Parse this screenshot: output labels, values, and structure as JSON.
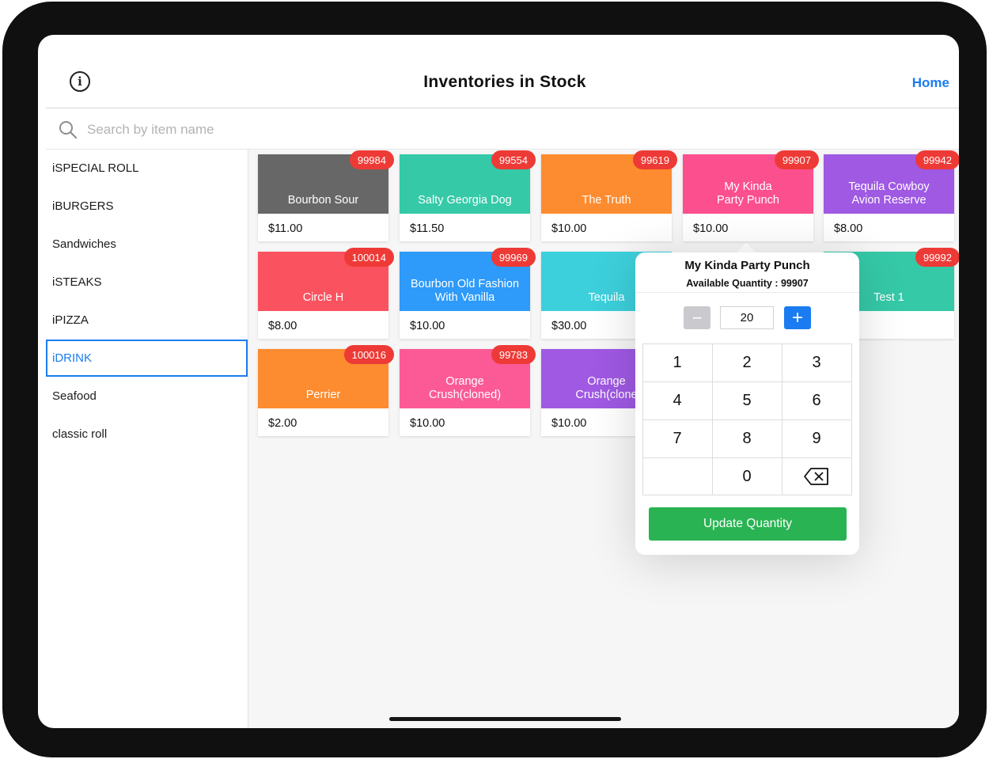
{
  "header": {
    "title": "Inventories in Stock",
    "home_label": "Home",
    "info_icon": "info-circle-icon"
  },
  "search": {
    "placeholder": "Search by item name",
    "icon": "search-icon"
  },
  "sidebar": {
    "selected": "iDRINK",
    "items": [
      {
        "label": "iSPECIAL ROLL"
      },
      {
        "label": "iBURGERS"
      },
      {
        "label": "Sandwiches"
      },
      {
        "label": "iSTEAKS"
      },
      {
        "label": "iPIZZA"
      },
      {
        "label": "iDRINK"
      },
      {
        "label": "Seafood"
      },
      {
        "label": "classic roll"
      }
    ]
  },
  "items": [
    {
      "name": "Bourbon Sour",
      "price": "$11.00",
      "stock": "99984",
      "color": "#676767"
    },
    {
      "name": "Salty Georgia Dog",
      "price": "$11.50",
      "stock": "99554",
      "color": "#35c9a8"
    },
    {
      "name": "The Truth",
      "price": "$10.00",
      "stock": "99619",
      "color": "#fd8b2f"
    },
    {
      "name": "My Kinda\nParty Punch",
      "price": "$10.00",
      "stock": "99907",
      "color": "#fb4f8e"
    },
    {
      "name": "Tequila Cowboy\nAvion Reserve",
      "price": "$8.00",
      "stock": "99942",
      "color": "#9f59e3"
    },
    {
      "name": "Circle H",
      "price": "$8.00",
      "stock": "100014",
      "color": "#fb5260"
    },
    {
      "name": "Bourbon Old Fashion\nWith Vanilla",
      "price": "$10.00",
      "stock": "99969",
      "color": "#2e9af9"
    },
    {
      "name": "Tequila",
      "price": "$30.00",
      "stock": "",
      "color": "#3cd0dc"
    },
    {
      "name": "Test 1",
      "price": "",
      "stock": "99992",
      "color": "#35c9a8"
    },
    {
      "name": "Perrier",
      "price": "$2.00",
      "stock": "100016",
      "color": "#fd8b2f"
    },
    {
      "name": "Orange\nCrush(cloned)",
      "price": "$10.00",
      "stock": "99783",
      "color": "#fb5a96"
    },
    {
      "name": "Orange\nCrush(clone",
      "price": "$10.00",
      "stock": "",
      "color": "#9f59e3"
    }
  ],
  "popover": {
    "title": "My Kinda Party Punch",
    "available": "Available Quantity : 99907",
    "minus_label": "−",
    "quantity": "20",
    "plus_label": "+",
    "keys": [
      "1",
      "2",
      "3",
      "4",
      "5",
      "6",
      "7",
      "8",
      "9",
      "",
      "0",
      "backspace-icon"
    ],
    "update_label": "Update Quantity"
  },
  "colors": {
    "accent": "#1a7cf0",
    "badge": "#ee3a36",
    "update_button": "#29b352"
  }
}
